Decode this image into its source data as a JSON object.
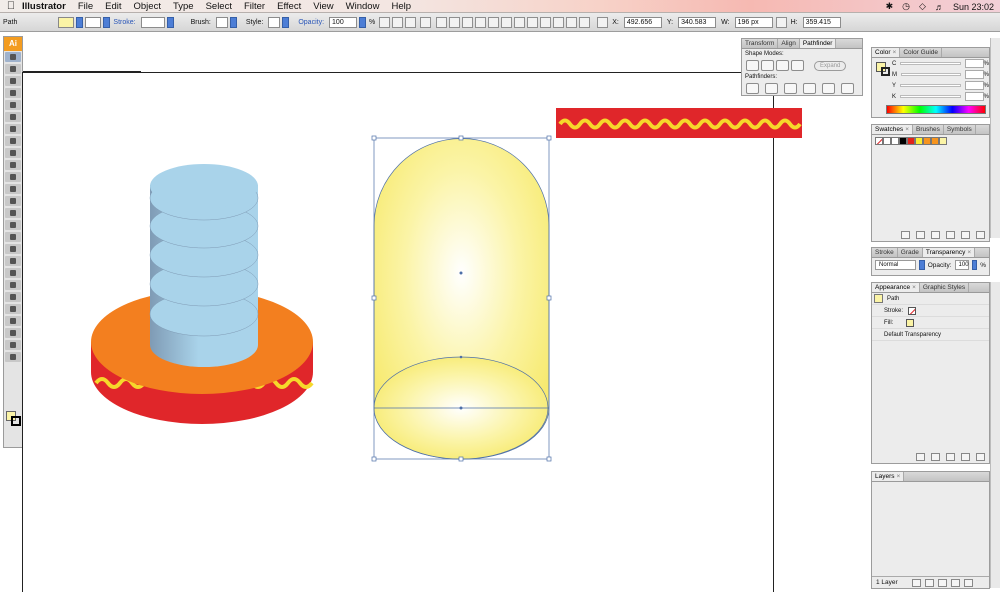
{
  "menubar": {
    "app_name": "Illustrator",
    "items": [
      "File",
      "Edit",
      "Object",
      "Type",
      "Select",
      "Filter",
      "Effect",
      "View",
      "Window",
      "Help"
    ],
    "clock": "Sun 23:02"
  },
  "controlbar": {
    "selection_type": "Path",
    "stroke_label": "Stroke:",
    "brush_label": "Brush:",
    "style_label": "Style:",
    "opacity_label": "Opacity:",
    "opacity_value": "100",
    "opacity_unit": "%",
    "x_label": "X:",
    "x_value": "492.656",
    "y_label": "Y:",
    "y_value": "340.583",
    "w_label": "W:",
    "w_value": "196 px",
    "h_label": "H:",
    "h_value": "359.415"
  },
  "tools": {
    "logo": "Ai"
  },
  "pathfinder_panel": {
    "tabs": [
      "Transform",
      "Align",
      "Pathfinder"
    ],
    "shape_modes_label": "Shape Modes:",
    "expand_label": "Expand",
    "pathfinders_label": "Pathfinders:"
  },
  "color_panel": {
    "tabs": [
      "Color",
      "Color Guide"
    ],
    "channels": [
      "C",
      "M",
      "Y",
      "K"
    ],
    "unit": "%"
  },
  "swatches_panel": {
    "tabs": [
      "Swatches",
      "Brushes",
      "Symbols"
    ],
    "colors": [
      "#ffffff",
      "#000000",
      "#e2231a",
      "#f9ed32",
      "#f7941d",
      "#f7941d",
      "#fbf4a6"
    ]
  },
  "stroke_panel": {
    "tabs": [
      "Stroke",
      "Grade",
      "Transparency"
    ],
    "blend_mode": "Normal",
    "opacity_label": "Opacity:",
    "opacity_value": "100",
    "opacity_unit": "%"
  },
  "appearance_panel": {
    "tabs": [
      "Appearance",
      "Graphic Styles"
    ],
    "object_label": "Path",
    "stroke_label": "Stroke:",
    "fill_label": "Fill:",
    "transparency_label": "Default Transparency"
  },
  "layers_panel": {
    "tabs": [
      "Layers"
    ],
    "status": "1 Layer"
  },
  "colors": {
    "stamp_orange": "#f37f1f",
    "stamp_red": "#e0262a",
    "wave_yellow": "#f6d82b",
    "stack_blue": "#a9d3ea",
    "capsule_yellow": "#f8ec7a",
    "selection_blue": "#4d6fa8"
  }
}
